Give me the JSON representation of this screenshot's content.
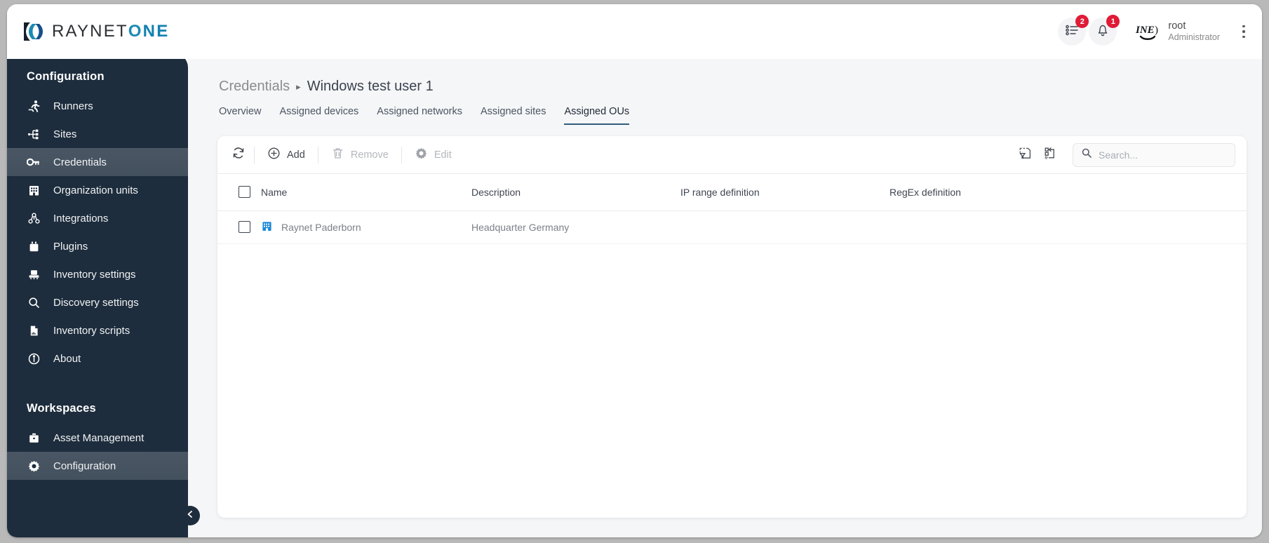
{
  "brand": {
    "name_dark": "RAYNET",
    "name_accent": "O",
    "name_accent2": "NE",
    "logo_icon": "raynet-logo-icon",
    "accent_color": "#1b8ab3",
    "sidebar_color": "#1e2d3d"
  },
  "topbar": {
    "tasks": {
      "icon": "task-list-icon",
      "badge": "2"
    },
    "notifications": {
      "icon": "bell-icon",
      "badge": "1"
    },
    "user": {
      "avatar_icon": "inet-avatar-icon",
      "name": "root",
      "role": "Administrator"
    },
    "more": {
      "icon": "kebab-menu-icon"
    }
  },
  "sidebar": {
    "section_configuration": "Configuration",
    "section_workspaces": "Workspaces",
    "collapse_icon": "chevron-left-icon",
    "items": [
      {
        "label": "Runners",
        "icon": "runner-icon",
        "active": false
      },
      {
        "label": "Sites",
        "icon": "sitemap-icon",
        "active": false
      },
      {
        "label": "Credentials",
        "icon": "key-icon",
        "active": true
      },
      {
        "label": "Organization units",
        "icon": "building-icon",
        "active": false
      },
      {
        "label": "Integrations",
        "icon": "integrations-icon",
        "active": false
      },
      {
        "label": "Plugins",
        "icon": "plug-icon",
        "active": false
      },
      {
        "label": "Inventory settings",
        "icon": "inventory-icon",
        "active": false
      },
      {
        "label": "Discovery settings",
        "icon": "search-icon",
        "active": false
      },
      {
        "label": "Inventory scripts",
        "icon": "script-file-icon",
        "active": false
      },
      {
        "label": "About",
        "icon": "info-icon",
        "active": false
      }
    ],
    "workspaces": [
      {
        "label": "Asset Management",
        "icon": "briefcase-icon",
        "active": false
      },
      {
        "label": "Configuration",
        "icon": "gear-icon",
        "active": true
      }
    ]
  },
  "breadcrumb": {
    "root": "Credentials",
    "separator": "▸",
    "current": "Windows test user 1"
  },
  "tabs": [
    {
      "label": "Overview",
      "active": false
    },
    {
      "label": "Assigned devices",
      "active": false
    },
    {
      "label": "Assigned networks",
      "active": false
    },
    {
      "label": "Assigned sites",
      "active": false
    },
    {
      "label": "Assigned OUs",
      "active": true
    }
  ],
  "toolbar": {
    "refresh_icon": "refresh-icon",
    "add_label": "Add",
    "add_icon": "plus-circle-icon",
    "remove_label": "Remove",
    "remove_icon": "trash-icon",
    "edit_label": "Edit",
    "edit_icon": "gear-icon",
    "export_icon": "export-filter-icon",
    "columns_icon": "column-layout-icon",
    "search_icon": "search-icon",
    "search_value": "",
    "search_placeholder": "Search..."
  },
  "table": {
    "select_all_icon": "checkbox-unchecked-icon",
    "columns": [
      "Name",
      "Description",
      "IP range definition",
      "RegEx definition"
    ],
    "rows": [
      {
        "checkbox_icon": "checkbox-unchecked-icon",
        "row_icon": "building-blue-icon",
        "name": "Raynet Paderborn",
        "description": "Headquarter Germany",
        "ip_range": "",
        "regex": ""
      }
    ]
  }
}
